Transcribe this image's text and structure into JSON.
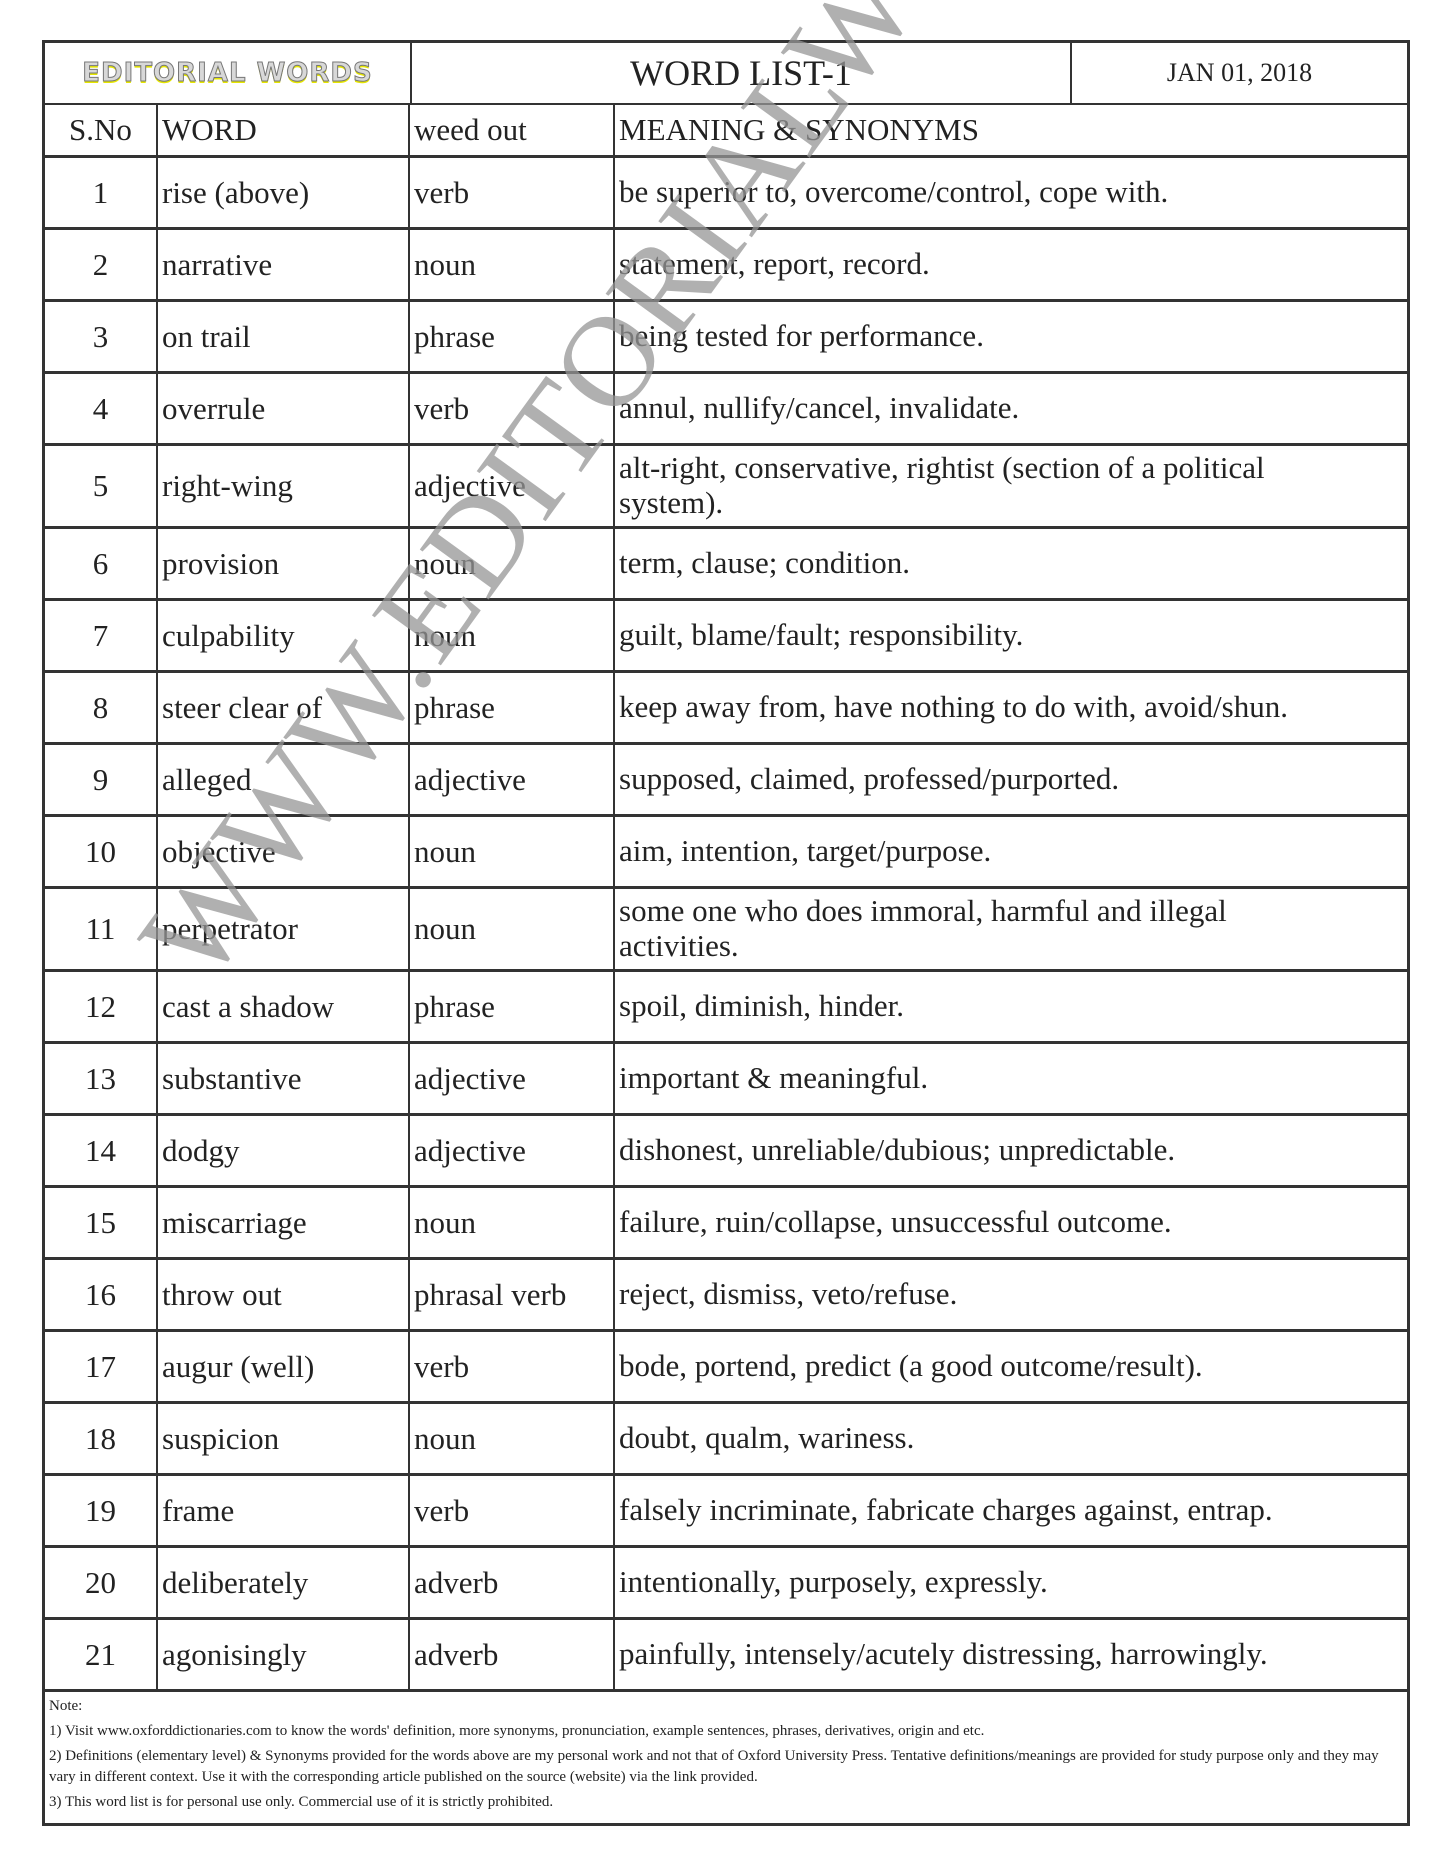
{
  "header": {
    "brand": "EDITORIAL WORDS",
    "title": "WORD LIST-1",
    "date": "JAN 01, 2018"
  },
  "columns": {
    "sno": "S.No",
    "word": "WORD",
    "pos": "weed out",
    "meaning": "MEANING & SYNONYMS"
  },
  "rows": [
    {
      "sno": "1",
      "word": "rise (above)",
      "pos": "verb",
      "meaning": "be superior to, overcome/control, cope with."
    },
    {
      "sno": "2",
      "word": "narrative",
      "pos": "noun",
      "meaning": "statement, report, record."
    },
    {
      "sno": "3",
      "word": "on trail",
      "pos": "phrase",
      "meaning": "being tested for performance."
    },
    {
      "sno": "4",
      "word": "overrule",
      "pos": "verb",
      "meaning": "annul, nullify/cancel, invalidate."
    },
    {
      "sno": "5",
      "word": "right-wing",
      "pos": "adjective",
      "meaning": "alt-right, conservative, rightist (section of a political system)."
    },
    {
      "sno": "6",
      "word": "provision",
      "pos": "noun",
      "meaning": "term, clause; condition."
    },
    {
      "sno": "7",
      "word": "culpability",
      "pos": "noun",
      "meaning": "guilt, blame/fault; responsibility."
    },
    {
      "sno": "8",
      "word": "steer clear of",
      "pos": "phrase",
      "meaning": "keep away from, have nothing to do with, avoid/shun."
    },
    {
      "sno": "9",
      "word": "alleged",
      "pos": "adjective",
      "meaning": "supposed, claimed, professed/purported."
    },
    {
      "sno": "10",
      "word": "objective",
      "pos": "noun",
      "meaning": "aim, intention, target/purpose."
    },
    {
      "sno": "11",
      "word": "perpetrator",
      "pos": "noun",
      "meaning": "some one who does immoral, harmful and illegal activities."
    },
    {
      "sno": "12",
      "word": "cast a shadow",
      "pos": "phrase",
      "meaning": "spoil, diminish, hinder."
    },
    {
      "sno": "13",
      "word": "substantive",
      "pos": "adjective",
      "meaning": "important & meaningful."
    },
    {
      "sno": "14",
      "word": "dodgy",
      "pos": "adjective",
      "meaning": "dishonest, unreliable/dubious; unpredictable."
    },
    {
      "sno": "15",
      "word": "miscarriage",
      "pos": "noun",
      "meaning": "failure, ruin/collapse, unsuccessful outcome."
    },
    {
      "sno": "16",
      "word": "throw out",
      "pos": "phrasal verb",
      "meaning": "reject, dismiss, veto/refuse."
    },
    {
      "sno": "17",
      "word": "augur (well)",
      "pos": "verb",
      "meaning": "bode, portend, predict (a good outcome/result)."
    },
    {
      "sno": "18",
      "word": "suspicion",
      "pos": "noun",
      "meaning": "doubt, qualm, wariness."
    },
    {
      "sno": "19",
      "word": "frame",
      "pos": "verb",
      "meaning": "falsely incriminate, fabricate charges against, entrap."
    },
    {
      "sno": "20",
      "word": "deliberately",
      "pos": "adverb",
      "meaning": "intentionally, purposely, expressly."
    },
    {
      "sno": "21",
      "word": "agonisingly",
      "pos": "adverb",
      "meaning": "painfully, intensely/acutely distressing, harrowingly."
    }
  ],
  "notes": {
    "label": "Note:",
    "items": [
      "1) Visit www.oxforddictionaries.com to know the words' definition, more synonyms, pronunciation, example sentences, phrases, derivatives, origin and etc.",
      "2) Definitions (elementary level) & Synonyms provided for the words above are my personal work and not that of Oxford University Press. Tentative definitions/meanings are provided for study purpose only and they may vary in different context. Use it with the corresponding article published on the source (website) via the link provided.",
      "3) This word list is for personal use only. Commercial use of it is strictly prohibited."
    ]
  },
  "watermark": "WWW.EDITORIALWORDS.COM"
}
